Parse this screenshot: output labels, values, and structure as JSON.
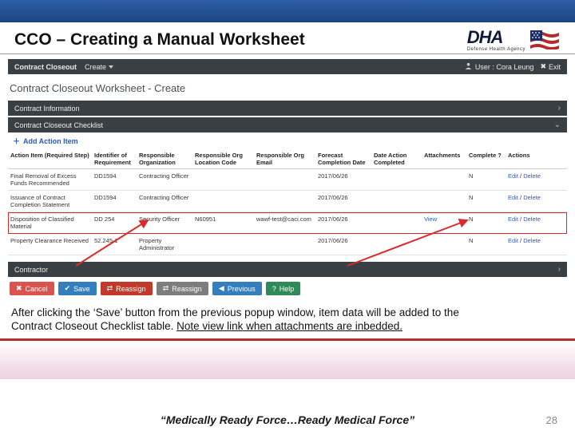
{
  "slide": {
    "title": "CCO – Creating a Manual Worksheet",
    "logo_text": "DHA",
    "logo_sub": "Defense Health Agency",
    "motto": "“Medically Ready Force…Ready Medical Force”",
    "page_number": "28"
  },
  "caption": {
    "line1": "After clicking the ‘Save’ button from the previous popup window, item data will be added to the",
    "line2_a": "Contract Closeout Checklist table. ",
    "line2_b": "Note view link when attachments are inbedded."
  },
  "appbar": {
    "brand": "Contract Closeout",
    "create": "Create",
    "user_label": "User : Cora Leung",
    "exit": "Exit"
  },
  "subtitle": "Contract Closeout Worksheet - Create",
  "panels": {
    "info": "Contract Information",
    "checklist": "Contract Closeout Checklist",
    "contractor": "Contractor"
  },
  "add_action": "Add Action Item",
  "table": {
    "headers": {
      "action_item": "Action Item (Required Step)",
      "identifier": "Identifier of Requirement",
      "resp_org": "Responsible Organization",
      "resp_loc": "Responsible Org Location Code",
      "resp_email": "Responsible Org Email",
      "forecast": "Forecast Completion Date",
      "completed": "Date Action Completed",
      "attachments": "Attachments",
      "complete": "Complete ?",
      "actions": "Actions"
    },
    "rows": [
      {
        "action_item": "Final Removal of Excess Funds Recommended",
        "identifier": "DD1594",
        "resp_org": "Contracting Officer",
        "resp_loc": "",
        "resp_email": "",
        "forecast": "2017/06/26",
        "completed": "",
        "attachments": "",
        "complete": "N",
        "edit": "Edit",
        "delete": "Delete"
      },
      {
        "action_item": "Issuance of Contract Completion Statement",
        "identifier": "DD1594",
        "resp_org": "Contracting Officer",
        "resp_loc": "",
        "resp_email": "",
        "forecast": "2017/06/26",
        "completed": "",
        "attachments": "",
        "complete": "N",
        "edit": "Edit",
        "delete": "Delete"
      },
      {
        "action_item": "Disposition of Classified Material",
        "identifier": "DD 254",
        "resp_org": "Security Officer",
        "resp_loc": "N60951",
        "resp_email": "wawf-test@caci.com",
        "forecast": "2017/06/26",
        "completed": "",
        "attachments": "View",
        "complete": "N",
        "edit": "Edit",
        "delete": "Delete"
      },
      {
        "action_item": "Property Clearance Received",
        "identifier": "52.245-1",
        "resp_org": "Property Administrator",
        "resp_loc": "",
        "resp_email": "",
        "forecast": "2017/06/26",
        "completed": "",
        "attachments": "",
        "complete": "N",
        "edit": "Edit",
        "delete": "Delete"
      }
    ]
  },
  "buttons": {
    "cancel": "Cancel",
    "save": "Save",
    "reassign": "Reassign",
    "previous": "Previous",
    "help": "Help"
  }
}
